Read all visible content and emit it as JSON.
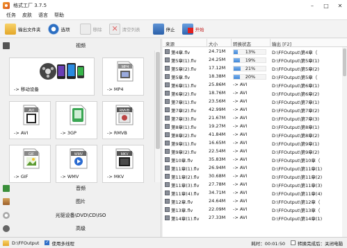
{
  "window": {
    "title": "格式工厂 3.7.5",
    "minimize": "–",
    "maximize": "□",
    "close": "✕"
  },
  "menu": [
    "任务",
    "皮肤",
    "语言",
    "帮助"
  ],
  "toolbar": {
    "output_folder": "输出文件夹",
    "options": "选项",
    "remove": "移除",
    "clear_list": "清空列表",
    "stop": "停止",
    "start": "开始"
  },
  "categories": {
    "video": "视频",
    "audio": "音频",
    "picture": "图片",
    "optical": "光驱设备\\DVD\\CD\\ISO",
    "advanced": "高级"
  },
  "tiles": [
    {
      "label": "-> 移动设备",
      "badge": ""
    },
    {
      "label": "-> MP4",
      "badge": "MP4"
    },
    {
      "label": "-> AVI",
      "badge": "AVI"
    },
    {
      "label": "-> 3GP",
      "badge": "3GP"
    },
    {
      "label": "-> RMVB",
      "badge": "RMVB"
    },
    {
      "label": "-> GIF",
      "badge": "GIF"
    },
    {
      "label": "-> WMV",
      "badge": "WMV"
    },
    {
      "label": "-> MKV",
      "badge": "MKV"
    }
  ],
  "table": {
    "headers": {
      "source": "来源",
      "size": "大小",
      "status": "转换状态",
      "output": "输出 [F2]"
    },
    "rows": [
      {
        "name": "第4章.flv",
        "size": "24.71M",
        "progress": 13,
        "status": "13%",
        "output": "D:\\FFOutput\\第4章（"
      },
      {
        "name": "第5章(1).flv",
        "size": "24.25M",
        "progress": 19,
        "status": "19%",
        "output": "D:\\FFOutput\\第5章(1)"
      },
      {
        "name": "第5章(2).flv",
        "size": "17.12M",
        "progress": 21,
        "status": "21%",
        "output": "D:\\FFOutput\\第5章(2)"
      },
      {
        "name": "第5章.flv",
        "size": "18.38M",
        "progress": 20,
        "status": "20%",
        "output": "D:\\FFOutput\\第5章（"
      },
      {
        "name": "第6章(1).flv",
        "size": "25.86M",
        "status": "-> AVI",
        "output": "D:\\FFOutput\\第6章(1)"
      },
      {
        "name": "第6章(2).flv",
        "size": "18.76M",
        "status": "-> AVI",
        "output": "D:\\FFOutput\\第6章(2)"
      },
      {
        "name": "第7章(1).flv",
        "size": "23.56M",
        "status": "-> AVI",
        "output": "D:\\FFOutput\\第7章(1)"
      },
      {
        "name": "第7章(2).flv",
        "size": "42.99M",
        "status": "-> AVI",
        "output": "D:\\FFOutput\\第7章(2)"
      },
      {
        "name": "第7章(3).flv",
        "size": "21.67M",
        "status": "-> AVI",
        "output": "D:\\FFOutput\\第7章(3)"
      },
      {
        "name": "第8章(1).flv",
        "size": "19.27M",
        "status": "-> AVI",
        "output": "D:\\FFOutput\\第8章(1)"
      },
      {
        "name": "第8章(2).flv",
        "size": "41.84M",
        "status": "-> AVI",
        "output": "D:\\FFOutput\\第8章(2)"
      },
      {
        "name": "第9章(1).flv",
        "size": "16.65M",
        "status": "-> AVI",
        "output": "D:\\FFOutput\\第9章(1)"
      },
      {
        "name": "第9章(2).flv",
        "size": "22.54M",
        "status": "-> AVI",
        "output": "D:\\FFOutput\\第9章(2)"
      },
      {
        "name": "第10章.flv",
        "size": "35.83M",
        "status": "-> AVI",
        "output": "D:\\FFOutput\\第10章（"
      },
      {
        "name": "第11章(1).flv",
        "size": "26.94M",
        "status": "-> AVI",
        "output": "D:\\FFOutput\\第11章(1)"
      },
      {
        "name": "第11章(2).flv",
        "size": "30.68M",
        "status": "-> AVI",
        "output": "D:\\FFOutput\\第11章(2)"
      },
      {
        "name": "第11章(3).flv",
        "size": "27.78M",
        "status": "-> AVI",
        "output": "D:\\FFOutput\\第11章(3)"
      },
      {
        "name": "第11章(4).flv",
        "size": "34.71M",
        "status": "-> AVI",
        "output": "D:\\FFOutput\\第11章(4)"
      },
      {
        "name": "第12章.flv",
        "size": "24.64M",
        "status": "-> AVI",
        "output": "D:\\FFOutput\\第12章（"
      },
      {
        "name": "第13章.flv",
        "size": "22.09M",
        "status": "-> AVI",
        "output": "D:\\FFOutput\\第13章（"
      },
      {
        "name": "第14章(1).flv",
        "size": "27.33M",
        "status": "-> AVI",
        "output": "D:\\FFOutput\\第14章(1)"
      }
    ]
  },
  "statusbar": {
    "output_path": "D:\\FFOutput",
    "multithread_label": "使用多线程",
    "multithread_checked": true,
    "elapsed_label": "耗时：00:01:50",
    "after_done_label": "转换完成后：关闭电脑",
    "after_done_checked": false
  },
  "colors": {
    "progress_fill": "#3d86d8",
    "accent": "#2c6fc2"
  }
}
